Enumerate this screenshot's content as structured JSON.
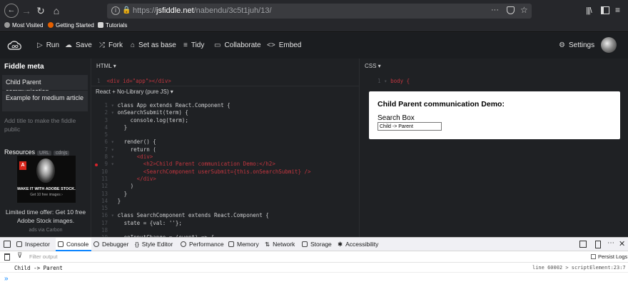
{
  "browser": {
    "url_domain": "jsfiddle.net",
    "url_path": "/nabendu/3c5t1juh/13/",
    "url_prefix": "https://",
    "bookmarks": [
      "Most Visited",
      "Getting Started",
      "Tutorials"
    ]
  },
  "toolbar": {
    "run": "Run",
    "save": "Save",
    "fork": "Fork",
    "set_as_base": "Set as base",
    "tidy": "Tidy",
    "collaborate": "Collaborate",
    "embed": "Embed",
    "settings": "Settings"
  },
  "sidebar": {
    "title": "Fiddle meta",
    "name_value": "Child Parent communication",
    "description_value": "Example for medium article",
    "help": "Add title to make the fiddle public",
    "resources": "Resources",
    "resources_pills": [
      "URL",
      "cdnjs"
    ]
  },
  "ad": {
    "tagline": "MAKE IT WITH ADOBE STOCK.",
    "sub": "Get 10 free images ›",
    "offer": "Limited time offer: Get 10 free Adobe Stock images.",
    "via": "ads via Carbon"
  },
  "html_pane": {
    "label": "HTML",
    "line1": "<div id=\"app\"></div>",
    "js_label": "React + No-Library (pure JS)"
  },
  "js_lines": [
    {
      "n": "1",
      "t": "class App extends React.Component {"
    },
    {
      "n": "2",
      "t": "onSearchSubmit(term) {"
    },
    {
      "n": "3",
      "t": "    console.log(term);"
    },
    {
      "n": "4",
      "t": "  }"
    },
    {
      "n": "5",
      "t": ""
    },
    {
      "n": "6",
      "t": "  render() {"
    },
    {
      "n": "7",
      "t": "    return ("
    },
    {
      "n": "8",
      "t": "      <div>"
    },
    {
      "n": "9",
      "t": "        <h2>Child Parent communication Demo:</h2>"
    },
    {
      "n": "10",
      "t": "        <SearchComponent userSubmit={this.onSearchSubmit} />"
    },
    {
      "n": "11",
      "t": "      </div>"
    },
    {
      "n": "12",
      "t": "    )"
    },
    {
      "n": "13",
      "t": "  }"
    },
    {
      "n": "14",
      "t": "}"
    },
    {
      "n": "15",
      "t": ""
    },
    {
      "n": "16",
      "t": "class SearchComponent extends React.Component {"
    },
    {
      "n": "17",
      "t": "  state = {val: ''};"
    },
    {
      "n": "18",
      "t": ""
    },
    {
      "n": "19",
      "t": "  onInputChange = (event) => {"
    }
  ],
  "css_pane": {
    "label": "CSS",
    "line1": "body {"
  },
  "result": {
    "heading": "Child Parent communication Demo:",
    "label": "Search Box",
    "input_value": "Child -> Parent"
  },
  "devtools": {
    "tabs": [
      "Inspector",
      "Console",
      "Debugger",
      "Style Editor",
      "Performance",
      "Memory",
      "Network",
      "Storage",
      "Accessibility"
    ],
    "filter_placeholder": "Filter output",
    "persist_logs": "Persist Logs",
    "log_message": "Child -> Parent",
    "log_source": "line 60002 > scriptElement:23:7",
    "prompt": "»"
  }
}
